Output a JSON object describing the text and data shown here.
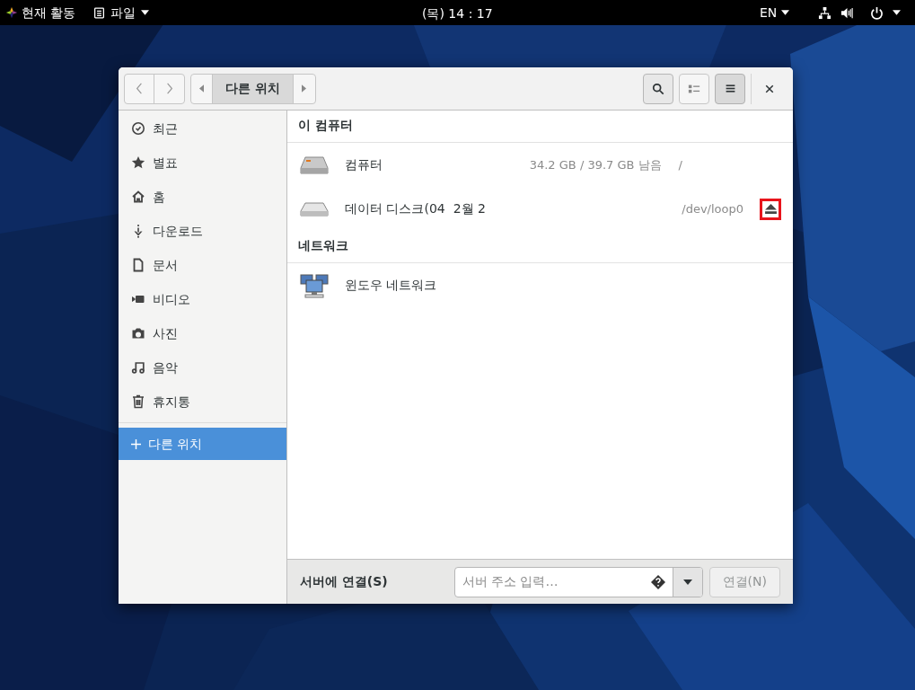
{
  "top_bar": {
    "activities": "현재 활동",
    "app_menu": "파일",
    "clock": "(목) 14 : 17",
    "language": "EN"
  },
  "window": {
    "path_bar": {
      "location": "다른 위치"
    },
    "view_menu_open": true,
    "sidebar": {
      "items": [
        {
          "label": "최근",
          "selected": false
        },
        {
          "label": "별표",
          "selected": false
        },
        {
          "label": "홈",
          "selected": false
        },
        {
          "label": "다운로드",
          "selected": false
        },
        {
          "label": "문서",
          "selected": false
        },
        {
          "label": "비디오",
          "selected": false
        },
        {
          "label": "사진",
          "selected": false
        },
        {
          "label": "음악",
          "selected": false
        },
        {
          "label": "휴지통",
          "selected": false
        }
      ],
      "other_locations": {
        "label": "다른 위치",
        "selected": true
      }
    },
    "sections": [
      {
        "title": "이 컴퓨터",
        "items": [
          {
            "kind": "drive",
            "name": "컴퓨터",
            "usage": "34.2 GB / 39.7 GB 남음",
            "path": "/"
          },
          {
            "kind": "disk",
            "name": "데이터 디스크(04  2월 2",
            "path": "/dev/loop0",
            "ejectable": true,
            "highlighted": true
          }
        ]
      },
      {
        "title": "네트워크",
        "items": [
          {
            "kind": "network",
            "name": "윈도우 네트워크"
          }
        ]
      }
    ],
    "connect_bar": {
      "label": "서버에 연결(S)",
      "placeholder": "서버 주소 입력…",
      "button": "연결(N)",
      "button_disabled": true
    }
  }
}
